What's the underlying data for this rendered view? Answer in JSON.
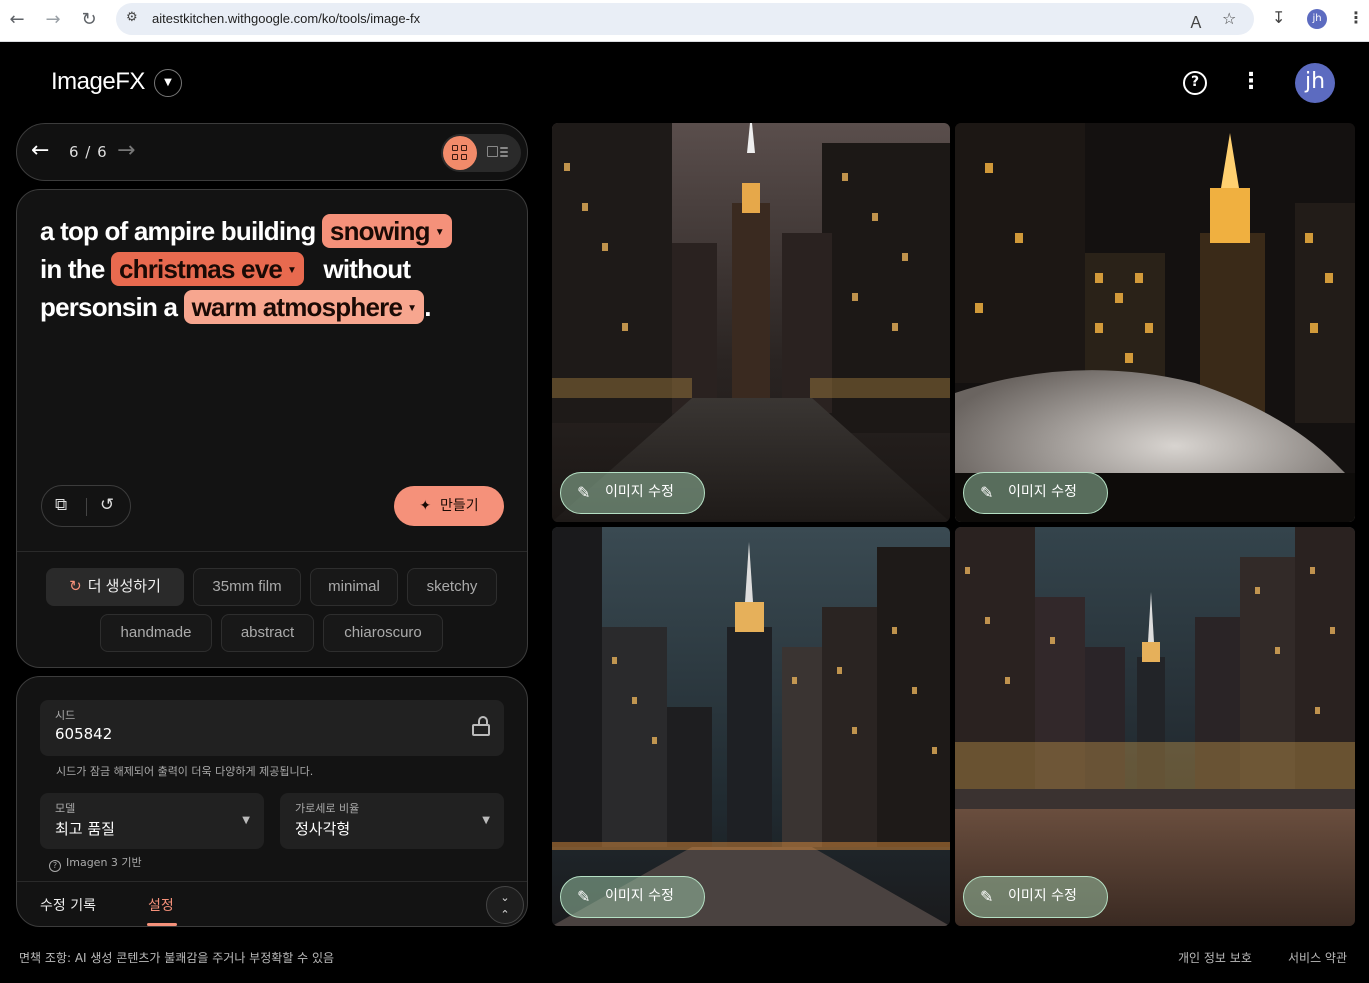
{
  "browser": {
    "url": "aitestkitchen.withgoogle.com/ko/tools/image-fx",
    "profile_initials": "jh"
  },
  "header": {
    "brand": "ImageFX",
    "avatar_initials": "jh"
  },
  "pager": {
    "count": "6 / 6"
  },
  "prompt": {
    "seg1": "a top of ampire building",
    "chip1": "snowing",
    "seg2": "in the",
    "chip2": "christmas eve",
    "seg3": "without",
    "seg4": "personsin a",
    "chip3": "warm atmosphere",
    "seg5": "."
  },
  "actions": {
    "make_label": "만들기"
  },
  "suggestions": {
    "more_label": "더 생성하기",
    "tags": [
      "35mm film",
      "minimal",
      "sketchy",
      "handmade",
      "abstract",
      "chiaroscuro"
    ]
  },
  "settings": {
    "seed_label": "시드",
    "seed_value": "605842",
    "seed_hint": "시드가 잠금 해제되어 출력이 더욱 다양하게 제공됩니다.",
    "model_label": "모델",
    "model_value": "최고 품질",
    "aspect_label": "가로세로 비율",
    "aspect_value": "정사각형",
    "imagen_note": "Imagen 3 기반",
    "tab_history": "수정 기록",
    "tab_settings": "설정"
  },
  "images": {
    "edit_label": "이미지 수정"
  },
  "footer": {
    "disclaimer": "면책 조항: AI 생성 콘텐츠가 불쾌감을 주거나 부정확할 수 있음",
    "privacy": "개인 정보 보호",
    "terms": "서비스 약관"
  },
  "colors": {
    "accent": "#f5917a",
    "background": "#000000",
    "card": "#131313"
  }
}
